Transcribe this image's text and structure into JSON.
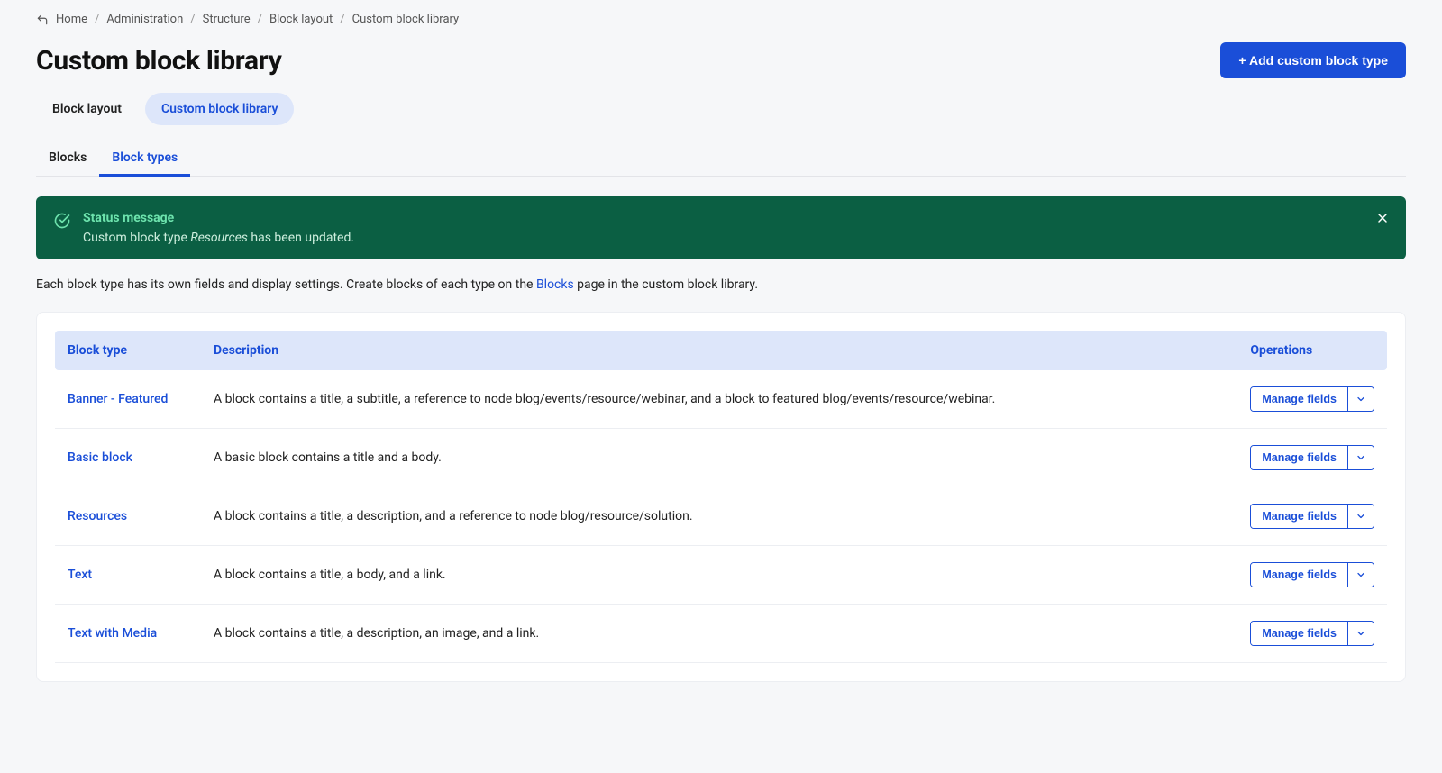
{
  "breadcrumbs": [
    {
      "label": "Home"
    },
    {
      "label": "Administration"
    },
    {
      "label": "Structure"
    },
    {
      "label": "Block layout"
    },
    {
      "label": "Custom block library"
    }
  ],
  "page_title": "Custom block library",
  "add_button_label": "+ Add custom block type",
  "tabs_primary": [
    {
      "label": "Block layout",
      "active": false
    },
    {
      "label": "Custom block library",
      "active": true
    }
  ],
  "tabs_secondary": [
    {
      "label": "Blocks",
      "active": false
    },
    {
      "label": "Block types",
      "active": true
    }
  ],
  "status": {
    "title": "Status message",
    "text_prefix": "Custom block type ",
    "text_emphasis": "Resources",
    "text_suffix": " has been updated."
  },
  "intro": {
    "prefix": "Each block type has its own fields and display settings. Create blocks of each type on the ",
    "link_label": "Blocks",
    "suffix": " page in the custom block library."
  },
  "table": {
    "headers": {
      "type": "Block type",
      "description": "Description",
      "operations": "Operations"
    },
    "op_button_label": "Manage fields",
    "rows": [
      {
        "type": "Banner - Featured",
        "description": "A block contains a title, a subtitle, a reference to node blog/events/resource/webinar, and a block to featured blog/events/resource/webinar."
      },
      {
        "type": "Basic block",
        "description": "A basic block contains a title and a body."
      },
      {
        "type": "Resources",
        "description": "A block contains a title, a description, and a reference to node blog/resource/solution."
      },
      {
        "type": "Text",
        "description": "A block contains a title, a body, and a link."
      },
      {
        "type": "Text with Media",
        "description": "A block contains a title, a description, an image, and a link."
      }
    ]
  }
}
